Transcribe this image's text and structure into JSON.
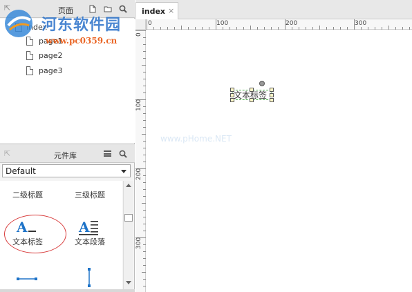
{
  "pages_panel": {
    "title": "页面",
    "collapse_glyph": "⇱",
    "tree": [
      {
        "label": "index",
        "selected": true
      },
      {
        "label": "page1"
      },
      {
        "label": "page2"
      },
      {
        "label": "page3"
      }
    ]
  },
  "watermark": {
    "site_name": "河东软件园",
    "url": "www.pc0359.cn",
    "canvas_ghost": "www.pHome.NET"
  },
  "library_panel": {
    "title": "元件库",
    "collapse_glyph": "⇱",
    "selected_library": "Default",
    "widgets": [
      {
        "label": "二级标题",
        "icon": "heading2-icon"
      },
      {
        "label": "三级标题",
        "icon": "heading3-icon"
      },
      {
        "label": "文本标签",
        "icon": "text-label-icon"
      },
      {
        "label": "文本段落",
        "icon": "text-paragraph-icon"
      },
      {
        "label": "",
        "icon": "horizontal-line-icon"
      },
      {
        "label": "",
        "icon": "vertical-line-icon"
      }
    ]
  },
  "editor": {
    "tab_label": "index",
    "tab_close": "×",
    "ruler_h": [
      "0",
      "100",
      "200",
      "300"
    ],
    "ruler_v": [
      "0",
      "100",
      "200",
      "300"
    ],
    "canvas_widget_text": "文本标签"
  },
  "colors": {
    "annotation_circle": "#d83b3b",
    "watermark_blue": "#2b72c9",
    "watermark_orange": "#e8560f",
    "widget_icon_blue": "#1e73c8"
  }
}
